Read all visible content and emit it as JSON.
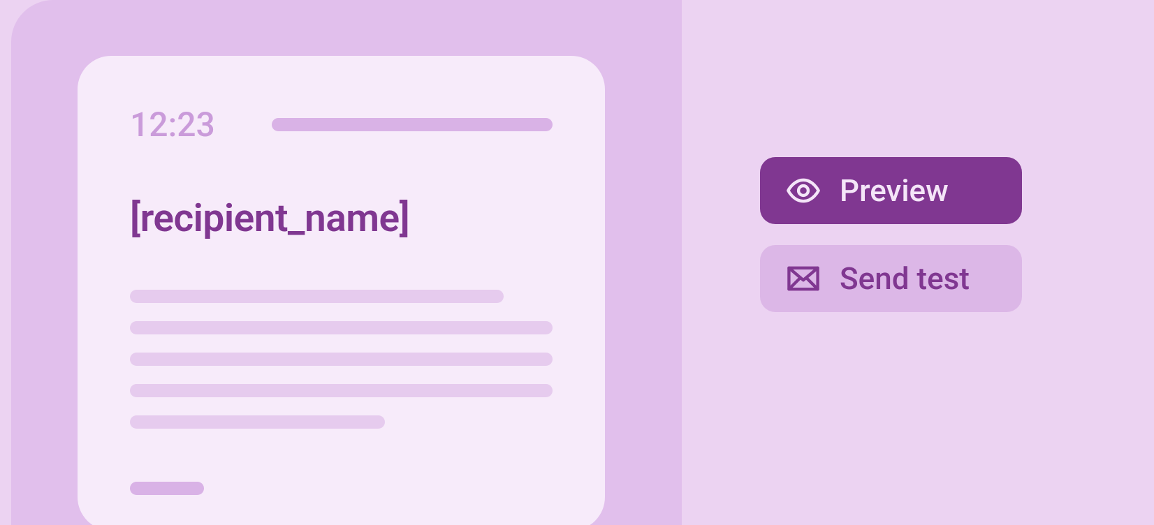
{
  "document": {
    "time": "12:23",
    "placeholder_text": "[recipient_name]"
  },
  "actions": {
    "preview_label": "Preview",
    "sendtest_label": "Send test"
  },
  "colors": {
    "accent": "#803791",
    "light_bg": "#ecd3f2",
    "mid_bg": "#e1bfec",
    "card_bg": "#f7ebfa"
  }
}
